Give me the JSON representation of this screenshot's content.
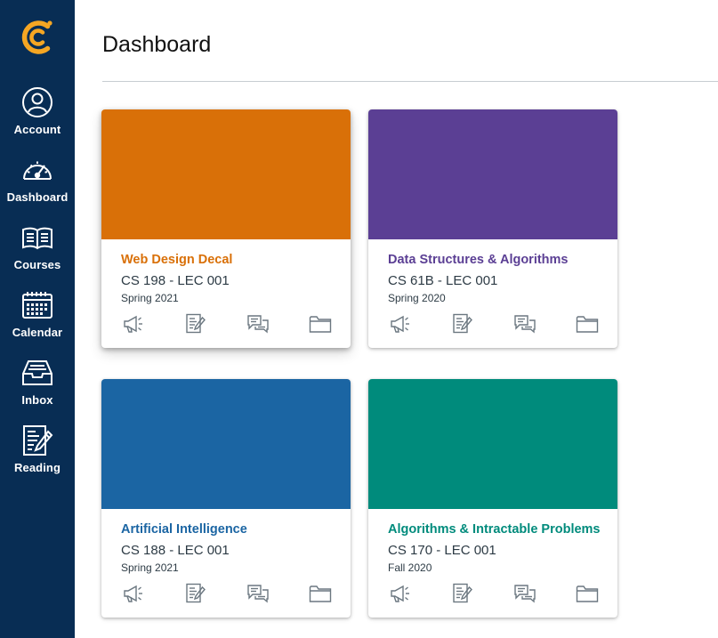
{
  "sidebar": {
    "logo_icon": "brand-logo-icon",
    "items": [
      {
        "label": "Account",
        "icon": "account-icon"
      },
      {
        "label": "Dashboard",
        "icon": "dashboard-icon"
      },
      {
        "label": "Courses",
        "icon": "courses-icon"
      },
      {
        "label": "Calendar",
        "icon": "calendar-icon"
      },
      {
        "label": "Inbox",
        "icon": "inbox-icon"
      },
      {
        "label": "Reading",
        "icon": "reading-icon"
      }
    ],
    "background": "#082d54",
    "logo_color": "#f5a623"
  },
  "header": {
    "title": "Dashboard"
  },
  "cards": [
    {
      "title": "Web Design Decal",
      "code": "CS 198 - LEC 001",
      "term": "Spring 2021",
      "color": "#d97008"
    },
    {
      "title": "Data Structures & Algorithms",
      "code": "CS 61B - LEC 001",
      "term": "Spring 2020",
      "color": "#5b3f94"
    },
    {
      "title": "Artificial Intelligence",
      "code": "CS 188 - LEC 001",
      "term": "Spring 2021",
      "color": "#1b65a3"
    },
    {
      "title": "Algorithms & Intractable Problems",
      "code": "CS 170 - LEC 001",
      "term": "Fall 2020",
      "color": "#008b7c"
    }
  ],
  "card_action_icons": [
    "announcements-icon",
    "assignments-icon",
    "discussions-icon",
    "files-icon"
  ]
}
